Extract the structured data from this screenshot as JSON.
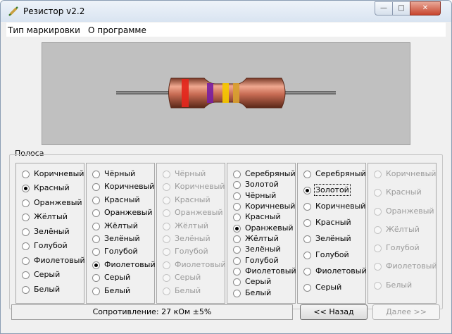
{
  "window": {
    "title": "Резистор v2.2",
    "controls": {
      "minimize": "—",
      "maximize": "□",
      "close": "✕"
    }
  },
  "menu": [
    "Тип маркировки",
    "О программе"
  ],
  "resistor": {
    "body_color": "#c66a52",
    "bands": [
      "#e4261c",
      "#7a1fa0",
      "#f5c800",
      "#d8a030"
    ]
  },
  "group_label": "Полоса",
  "columns": [
    {
      "enabled": true,
      "options": [
        "Коричневый",
        "Красный",
        "Оранжевый",
        "Жёлтый",
        "Зелёный",
        "Голубой",
        "Фиолетовый",
        "Серый",
        "Белый"
      ],
      "selected": 1
    },
    {
      "enabled": true,
      "options": [
        "Чёрный",
        "Коричневый",
        "Красный",
        "Оранжевый",
        "Жёлтый",
        "Зелёный",
        "Голубой",
        "Фиолетовый",
        "Серый",
        "Белый"
      ],
      "selected": 7
    },
    {
      "enabled": false,
      "options": [
        "Чёрный",
        "Коричневый",
        "Красный",
        "Оранжевый",
        "Жёлтый",
        "Зелёный",
        "Голубой",
        "Фиолетовый",
        "Серый",
        "Белый"
      ],
      "selected": -1
    },
    {
      "enabled": true,
      "options": [
        "Серебряный",
        "Золотой",
        "Чёрный",
        "Коричневый",
        "Красный",
        "Оранжевый",
        "Жёлтый",
        "Зелёный",
        "Голубой",
        "Фиолетовый",
        "Серый",
        "Белый"
      ],
      "selected": 5
    },
    {
      "enabled": true,
      "options": [
        "Серебряный",
        "Золотой",
        "Коричневый",
        "Красный",
        "Зелёный",
        "Голубой",
        "Фиолетовый",
        "Серый"
      ],
      "selected": 1
    },
    {
      "enabled": false,
      "options": [
        "Коричневый",
        "Красный",
        "Оранжевый",
        "Жёлтый",
        "Голубой",
        "Фиолетовый",
        "Белый"
      ],
      "selected": -1
    }
  ],
  "status": "Сопротивление: 27 кОм ±5%",
  "buttons": {
    "back": "<< Назад",
    "next": "Далее >>"
  }
}
